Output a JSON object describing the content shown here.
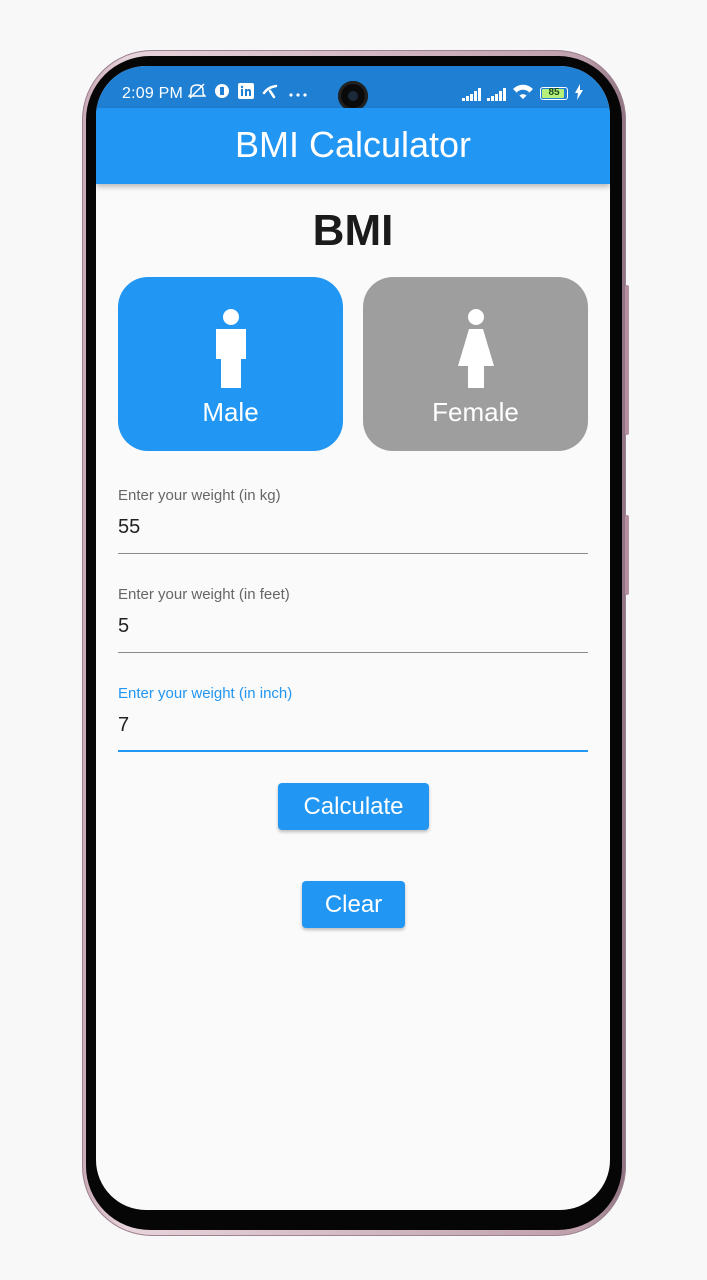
{
  "status_bar": {
    "time": "2:09 PM",
    "left_icons": [
      "mute-icon",
      "app-icon",
      "linkedin-icon",
      "telenor-icon",
      "more-icon"
    ],
    "battery_level": "85",
    "battery_fraction": 0.85
  },
  "app_bar": {
    "title": "BMI Calculator"
  },
  "page": {
    "heading": "BMI"
  },
  "gender": {
    "male_label": "Male",
    "female_label": "Female",
    "selected": "Male"
  },
  "fields": {
    "weight_kg": {
      "label": "Enter your weight (in kg)",
      "value": "55"
    },
    "height_feet": {
      "label": "Enter your weight (in feet)",
      "value": "5"
    },
    "height_inch": {
      "label": "Enter your weight (in inch)",
      "value": "7"
    }
  },
  "buttons": {
    "calculate_label": "Calculate",
    "clear_label": "Clear"
  },
  "colors": {
    "primary": "#2196f3",
    "status_bar": "#1e7fd3",
    "unselected_card": "#9e9e9e",
    "focused_underline": "#2196f3"
  }
}
